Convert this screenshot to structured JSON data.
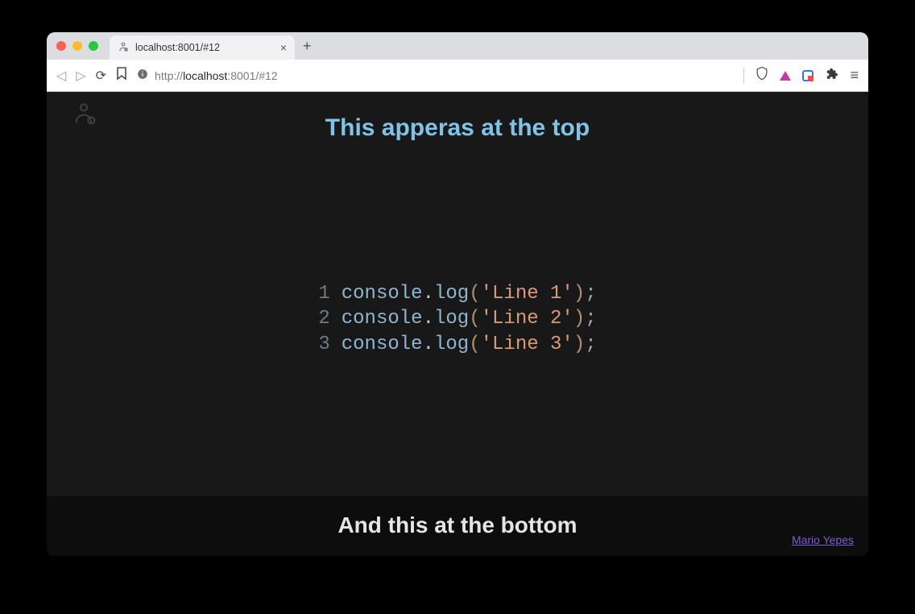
{
  "browser": {
    "tab": {
      "title": "localhost:8001/#12"
    },
    "url": {
      "scheme": "http://",
      "host": "localhost",
      "path": ":8001/#12"
    }
  },
  "page": {
    "top_heading": "This apperas at the top",
    "bottom_heading": "And this at the bottom",
    "author": "Mario Yepes",
    "code": {
      "lines": [
        {
          "n": "1",
          "obj": "console",
          "fn": "log",
          "str": "'Line 1'"
        },
        {
          "n": "2",
          "obj": "console",
          "fn": "log",
          "str": "'Line 2'"
        },
        {
          "n": "3",
          "obj": "console",
          "fn": "log",
          "str": "'Line 3'"
        }
      ]
    }
  }
}
